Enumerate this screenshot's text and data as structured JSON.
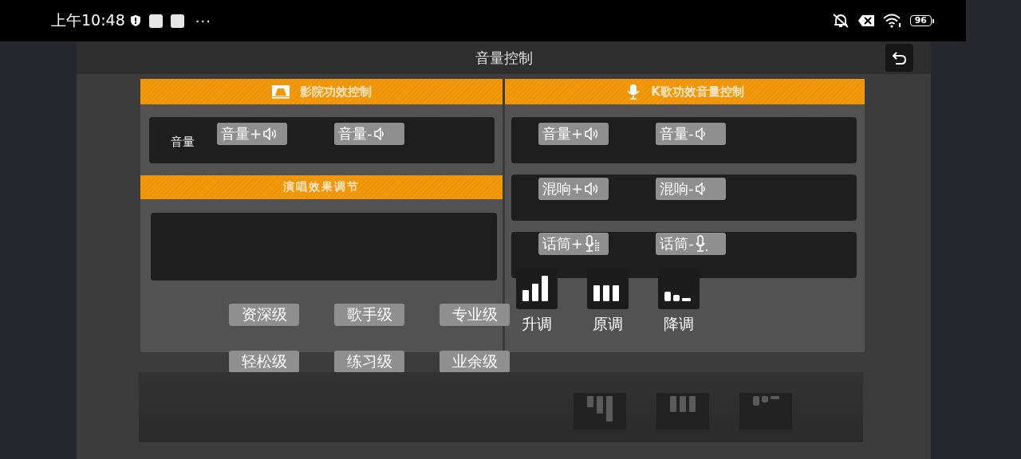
{
  "status_bar": {
    "time": "上午10:48",
    "more": "···",
    "battery": "96"
  },
  "header": {
    "title": "音量控制"
  },
  "cinema": {
    "title": "影院功效控制",
    "rows": [
      {
        "label": "音量",
        "buttons": [
          {
            "text": "音量+",
            "kind": "speaker-up"
          },
          {
            "text": "音量-",
            "kind": "speaker-down"
          }
        ]
      }
    ]
  },
  "singing": {
    "title": "演唱效果调节",
    "levels": [
      "资深级",
      "歌手级",
      "专业级",
      "轻松级",
      "练习级",
      "业余级"
    ]
  },
  "karaoke": {
    "title": "K歌功效音量控制",
    "rows": [
      {
        "buttons": [
          {
            "text": "音量+",
            "kind": "speaker-up"
          },
          {
            "text": "音量-",
            "kind": "speaker-down"
          }
        ]
      },
      {
        "buttons": [
          {
            "text": "混响+",
            "kind": "speaker-up"
          },
          {
            "text": "混响-",
            "kind": "speaker-down"
          }
        ]
      },
      {
        "buttons": [
          {
            "text": "话筒+",
            "kind": "mic-up"
          },
          {
            "text": "话筒-",
            "kind": "mic-down"
          }
        ]
      }
    ],
    "keys": [
      {
        "label": "升调",
        "kind": "up"
      },
      {
        "label": "原调",
        "kind": "flat"
      },
      {
        "label": "降调",
        "kind": "down"
      }
    ]
  },
  "reflection": {
    "keys": [
      {
        "kind": "up"
      },
      {
        "kind": "flat"
      },
      {
        "kind": "down"
      }
    ]
  }
}
